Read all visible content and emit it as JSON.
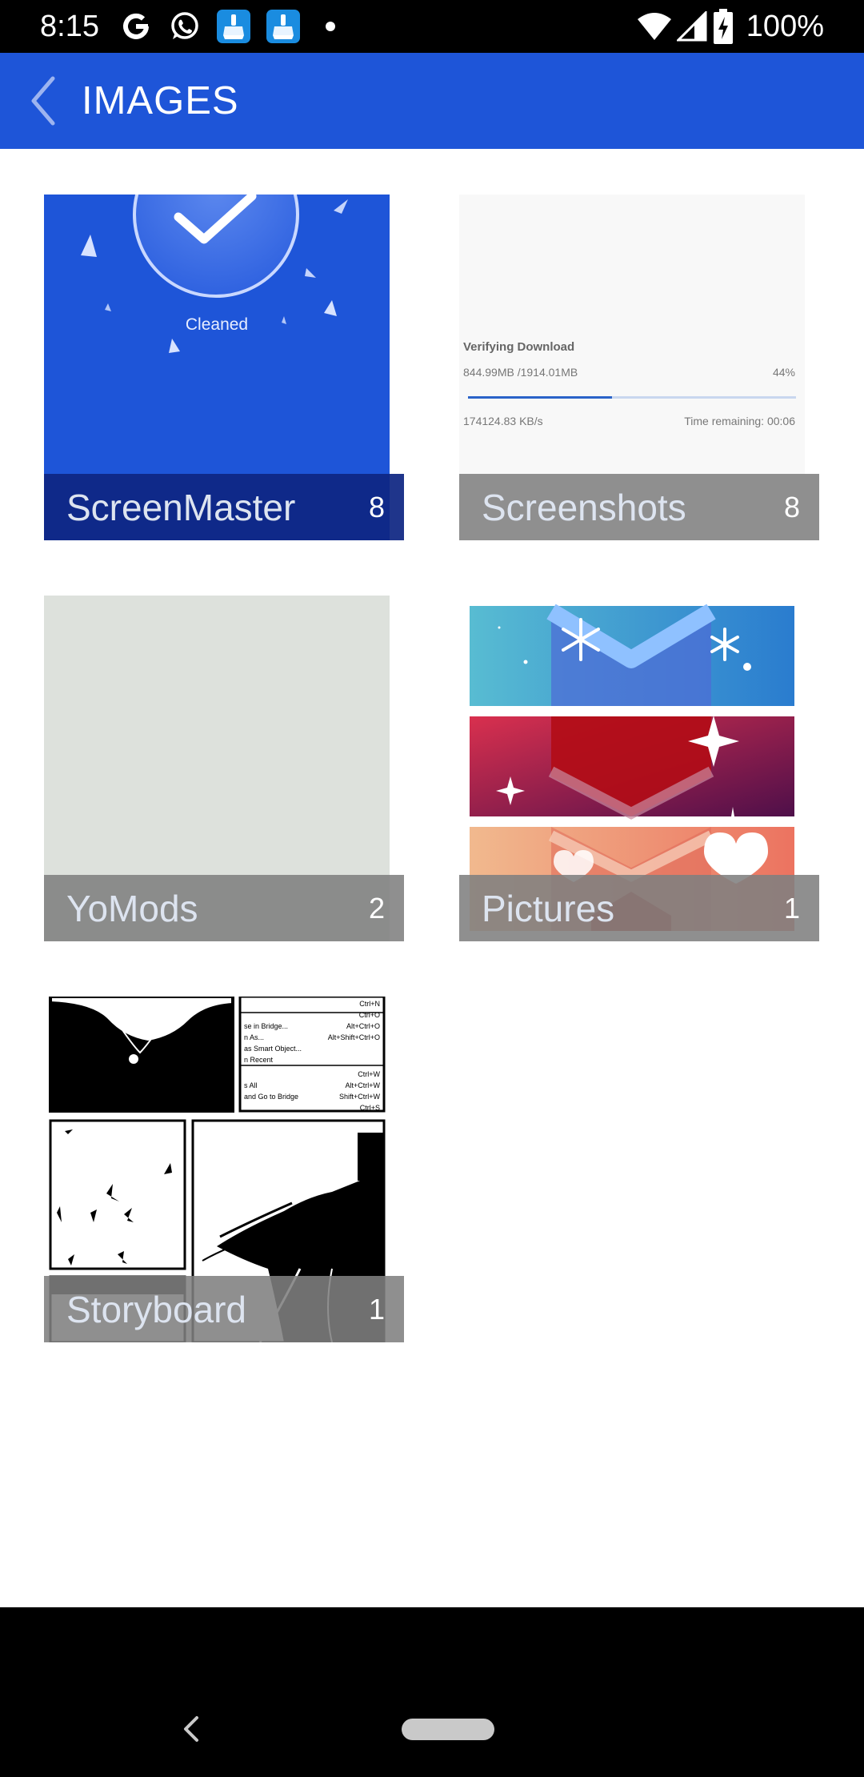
{
  "status_bar": {
    "time": "8:15",
    "battery": "100%",
    "icons": [
      "google-g-icon",
      "whatsapp-icon",
      "cleaner-app-icon",
      "cleaner-app-icon",
      "notification-dot-icon",
      "wifi-icon",
      "cell-signal-icon",
      "battery-charging-icon"
    ]
  },
  "app_bar": {
    "title": "IMAGES",
    "back_icon": "chevron-left-icon",
    "color": "#1e55d8"
  },
  "folders": [
    {
      "name": "ScreenMaster",
      "count": "8",
      "thumbnail": {
        "text": "Cleaned",
        "background": "#1e55d8"
      }
    },
    {
      "name": "Screenshots",
      "count": "8",
      "thumbnail": {
        "title": "Verifying Download",
        "size": "844.99MB /1914.01MB",
        "percent": "44%",
        "speed": "174124.83 KB/s",
        "remaining": "Time remaining: 00:06",
        "progress": 0.44
      }
    },
    {
      "name": "YoMods",
      "count": "2",
      "thumbnail": {
        "background": "#dde1dc"
      }
    },
    {
      "name": "Pictures",
      "count": "1"
    },
    {
      "name": "Storyboard",
      "count": "1",
      "thumbnail": {
        "menu_lines": [
          "Ctrl+N",
          "Ctrl+O",
          "se in Bridge...",
          "Alt+Ctrl+O",
          "n As...",
          "Alt+Shift+Ctrl+O",
          "as Smart Object...",
          "n Recent",
          "Ctrl+W",
          "s All",
          "Alt+Ctrl+W",
          "and Go to Bridge",
          "Shift+Ctrl+W",
          "Ctrl+S"
        ]
      }
    }
  ],
  "nav_bar": {
    "back_icon": "nav-back-icon",
    "home_icon": "nav-home-pill-icon"
  }
}
